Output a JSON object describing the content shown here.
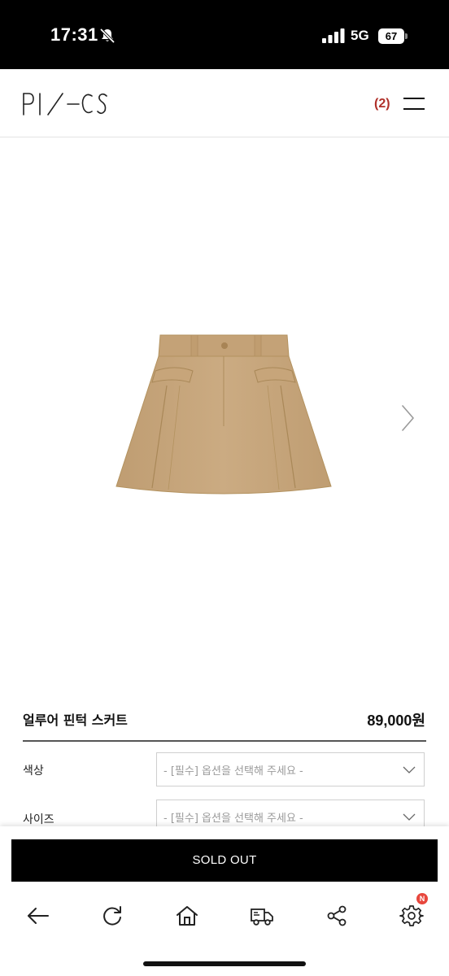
{
  "status_bar": {
    "time": "17:31",
    "network": "5G",
    "battery": "67",
    "icons": [
      "bell-slash-icon",
      "signal-icon",
      "battery-icon"
    ]
  },
  "header": {
    "logo_text": "PI/CS",
    "cart_count": "(2)",
    "icons": [
      "menu-icon"
    ]
  },
  "gallery": {
    "image": "beige-skirt",
    "icons": [
      "chevron-right-icon"
    ]
  },
  "product": {
    "name": "얼루어 핀턱 스커트",
    "price": "89,000원"
  },
  "options": [
    {
      "label": "색상",
      "placeholder": "- [필수] 옵션을 선택해 주세요 -"
    },
    {
      "label": "사이즈",
      "placeholder": "- [필수] 옵션을 선택해 주세요 -"
    }
  ],
  "bottom": {
    "sold_out_label": "SOLD OUT",
    "tabbar": [
      {
        "icon": "back-arrow-icon"
      },
      {
        "icon": "refresh-icon"
      },
      {
        "icon": "home-icon"
      },
      {
        "icon": "delivery-truck-icon"
      },
      {
        "icon": "share-icon"
      },
      {
        "icon": "settings-icon",
        "badge": "N"
      }
    ]
  },
  "colors": {
    "cart_count": "#b0302a",
    "badge": "#e8473d",
    "skirt": "#c7a67d"
  }
}
